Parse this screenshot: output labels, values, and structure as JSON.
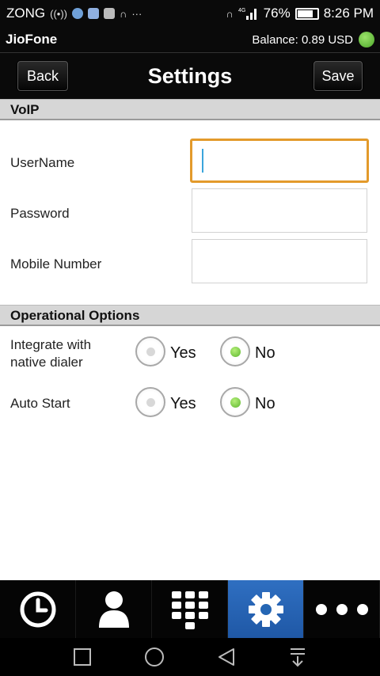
{
  "status_bar": {
    "carrier": "ZONG",
    "battery": "76%",
    "time": "8:26 PM",
    "network": "4G"
  },
  "app_bar": {
    "app_name": "JioFone",
    "balance": "Balance: 0.89 USD"
  },
  "header": {
    "back_label": "Back",
    "title": "Settings",
    "save_label": "Save"
  },
  "voip": {
    "section_title": "VoIP",
    "username_label": "UserName",
    "username_value": "",
    "password_label": "Password",
    "password_value": "",
    "mobile_label": "Mobile Number",
    "mobile_value": ""
  },
  "options": {
    "section_title": "Operational Options",
    "integrate_label_1": "Integrate with",
    "integrate_label_2": "native dialer",
    "integrate_yes": "Yes",
    "integrate_no": "No",
    "integrate_selected": "No",
    "autostart_label": "Auto Start",
    "autostart_yes": "Yes",
    "autostart_no": "No",
    "autostart_selected": "No"
  },
  "tabs": [
    {
      "icon": "clock-icon",
      "active": false
    },
    {
      "icon": "contact-icon",
      "active": false
    },
    {
      "icon": "dialpad-icon",
      "active": false
    },
    {
      "icon": "gear-icon",
      "active": true
    },
    {
      "icon": "more-icon",
      "active": false
    }
  ],
  "colors": {
    "focus_border": "#e39a2b",
    "active_tab": "#2f6fc1",
    "radio_on": "#5cb52e"
  }
}
